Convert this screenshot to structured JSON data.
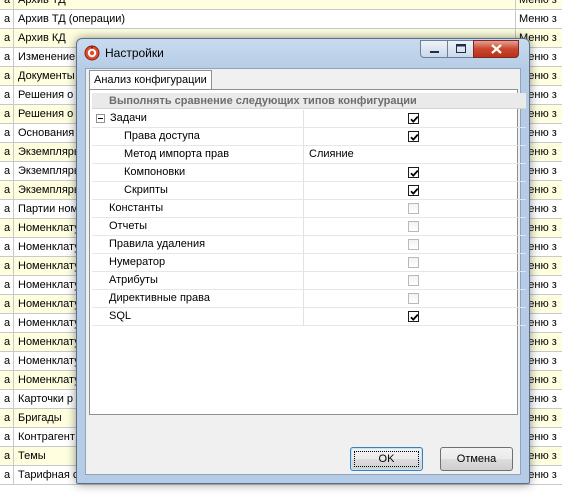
{
  "background_table": {
    "rows": [
      {
        "prefix": "а",
        "name": "Архив ТД",
        "extra": "Меню з"
      },
      {
        "prefix": "а",
        "name": "Архив ТД (операции)",
        "extra": "Меню з"
      },
      {
        "prefix": "а",
        "name": "Архив КД",
        "extra": "Меню з"
      },
      {
        "prefix": "а",
        "name": "Изменение",
        "extra": "Меню з"
      },
      {
        "prefix": "а",
        "name": "Документы",
        "extra": "Меню з"
      },
      {
        "prefix": "а",
        "name": "Решения о з",
        "extra": "Меню з"
      },
      {
        "prefix": "а",
        "name": "Решения о з",
        "extra": "Меню з"
      },
      {
        "prefix": "а",
        "name": "Основания",
        "extra": "Меню з"
      },
      {
        "prefix": "а",
        "name": "Экземпляры",
        "extra": "Меню з"
      },
      {
        "prefix": "а",
        "name": "Экземпляры",
        "extra": "Меню з"
      },
      {
        "prefix": "а",
        "name": "Экземпляры",
        "extra": "Меню з"
      },
      {
        "prefix": "а",
        "name": "Партии ном",
        "extra": "Меню з"
      },
      {
        "prefix": "а",
        "name": "Номенклату",
        "extra": "Меню з"
      },
      {
        "prefix": "а",
        "name": "Номенклату",
        "extra": "Меню з"
      },
      {
        "prefix": "а",
        "name": "Номенклату",
        "extra": "Меню з"
      },
      {
        "prefix": "а",
        "name": "Номенклату",
        "extra": "Меню з"
      },
      {
        "prefix": "а",
        "name": "Номенклату",
        "extra": "Меню з"
      },
      {
        "prefix": "а",
        "name": "Номенклату",
        "extra": "Меню з"
      },
      {
        "prefix": "а",
        "name": "Номенклату",
        "extra": "Меню з"
      },
      {
        "prefix": "а",
        "name": "Номенклату",
        "extra": "Меню з"
      },
      {
        "prefix": "а",
        "name": "Номенклату",
        "extra": "Меню з"
      },
      {
        "prefix": "а",
        "name": "Карточки р",
        "extra": "Меню з"
      },
      {
        "prefix": "а",
        "name": "Бригады",
        "extra": "Меню з"
      },
      {
        "prefix": "а",
        "name": "Контрагент",
        "extra": "Меню з"
      },
      {
        "prefix": "а",
        "name": "Темы",
        "extra": "Меню з"
      },
      {
        "prefix": "а",
        "name": "Тарифная с",
        "extra": "Меню з"
      }
    ]
  },
  "dialog": {
    "title": "Настройки",
    "tab_label": "Анализ конфигурации",
    "grid_header": "Выполнять сравнение следующих типов конфигурации",
    "rows": [
      {
        "label": "Задачи",
        "checked": true,
        "group": true
      },
      {
        "label": "Права доступа",
        "checked": true
      },
      {
        "label": "Метод импорта прав",
        "value": "Слияние"
      },
      {
        "label": "Компоновки",
        "checked": true
      },
      {
        "label": "Скрипты",
        "checked": true
      },
      {
        "label": "Константы",
        "checked": false
      },
      {
        "label": "Отчеты",
        "checked": false
      },
      {
        "label": "Правила удаления",
        "checked": false
      },
      {
        "label": "Нумератор",
        "checked": false
      },
      {
        "label": "Атрибуты",
        "checked": false
      },
      {
        "label": "Директивные права",
        "checked": false
      },
      {
        "label": "SQL",
        "checked": true
      }
    ],
    "ok_label": "OK",
    "cancel_label": "Отмена"
  },
  "icons": {
    "app": "settings-app-icon",
    "minimize": "minimize-icon",
    "maximize": "maximize-icon",
    "close": "close-icon",
    "expander": "collapse-icon",
    "checkmark": "checkmark-icon"
  },
  "colors": {
    "row_alt": "#ffffe0",
    "title_bar": "#b6cce6",
    "close_button": "#c9462d"
  }
}
